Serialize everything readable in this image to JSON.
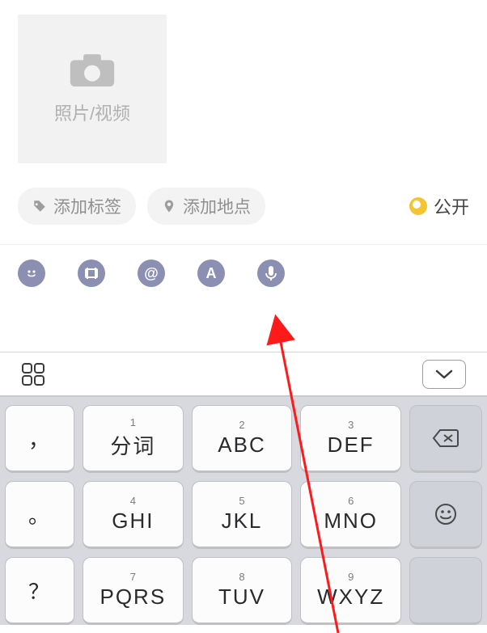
{
  "compose": {
    "photo_label": "照片/视频"
  },
  "chips": {
    "tag_label": "添加标签",
    "location_label": "添加地点"
  },
  "visibility": {
    "label": "公开"
  },
  "keypad": {
    "row1": {
      "k1": {
        "num": "1",
        "lbl": "分词"
      },
      "k2": {
        "num": "2",
        "lbl": "ABC"
      },
      "k3": {
        "num": "3",
        "lbl": "DEF"
      }
    },
    "row2": {
      "k1": {
        "num": "4",
        "lbl": "GHI"
      },
      "k2": {
        "num": "5",
        "lbl": "JKL"
      },
      "k3": {
        "num": "6",
        "lbl": "MNO"
      }
    },
    "row3": {
      "k1": {
        "num": "7",
        "lbl": "PQRS"
      },
      "k2": {
        "num": "8",
        "lbl": "TUV"
      },
      "k3": {
        "num": "9",
        "lbl": "WXYZ"
      }
    },
    "punct": {
      "p1": "，",
      "p2": "。",
      "p3": "？",
      "p4": "！"
    }
  }
}
